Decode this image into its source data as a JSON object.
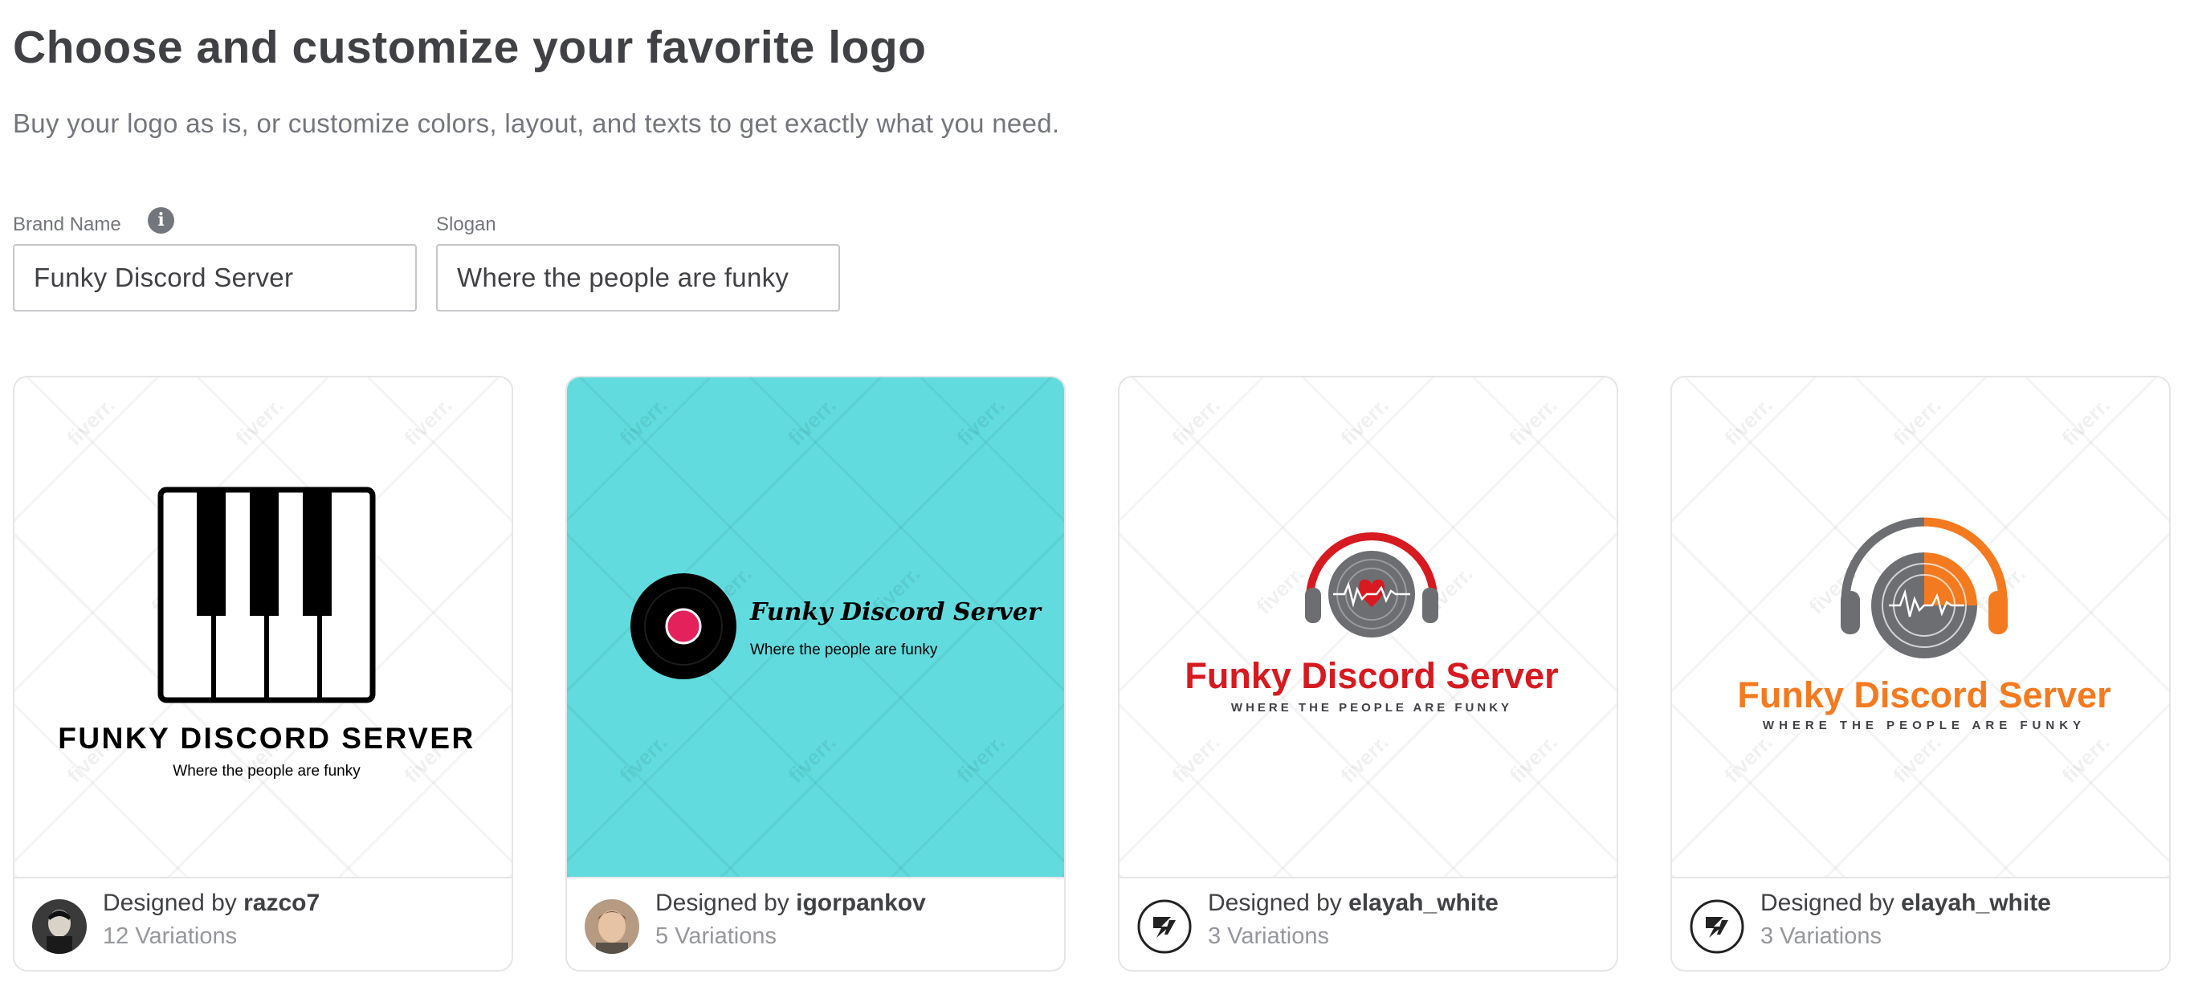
{
  "header": {
    "title": "Choose and customize your favorite logo",
    "subtitle": "Buy your logo as is, or customize colors, layout, and texts to get exactly what you need."
  },
  "form": {
    "brand_name_label": "Brand Name",
    "brand_name_value": "Funky Discord Server",
    "slogan_label": "Slogan",
    "slogan_value": "Where the people are funky"
  },
  "watermark_text": "fiverr.",
  "cards": [
    {
      "logo_style": "piano",
      "logo_title": "FUNKY DISCORD SERVER",
      "logo_slogan": "Where the people are funky",
      "designed_by_prefix": "Designed by ",
      "designer": "razco7",
      "variations": "12 Variations",
      "avatar_icon": "person-photo-avatar"
    },
    {
      "logo_style": "vinyl-record",
      "background_color": "#61dbde",
      "logo_title": "Funky Discord Server",
      "logo_slogan": "Where the people are funky",
      "designed_by_prefix": "Designed by ",
      "designer": "igorpankov",
      "variations": "5 Variations",
      "avatar_icon": "person-photo-avatar"
    },
    {
      "logo_style": "headphones",
      "accent_color": "#d71920",
      "logo_title": "Funky Discord Server",
      "logo_slogan": "WHERE THE PEOPLE ARE FUNKY",
      "designed_by_prefix": "Designed by ",
      "designer": "elayah_white",
      "variations": "3 Variations",
      "avatar_icon": "monogram-avatar"
    },
    {
      "logo_style": "headphones",
      "accent_color": "#f47a20",
      "logo_title": "Funky Discord Server",
      "logo_slogan": "WHERE THE PEOPLE ARE FUNKY",
      "designed_by_prefix": "Designed by ",
      "designer": "elayah_white",
      "variations": "3 Variations",
      "avatar_icon": "monogram-avatar"
    }
  ],
  "colors": {
    "text_primary": "#404145",
    "text_secondary": "#74767e",
    "border": "#e4e5e7",
    "teal_card": "#61dbde",
    "red_logo": "#d71920",
    "orange_logo": "#f47a20"
  }
}
